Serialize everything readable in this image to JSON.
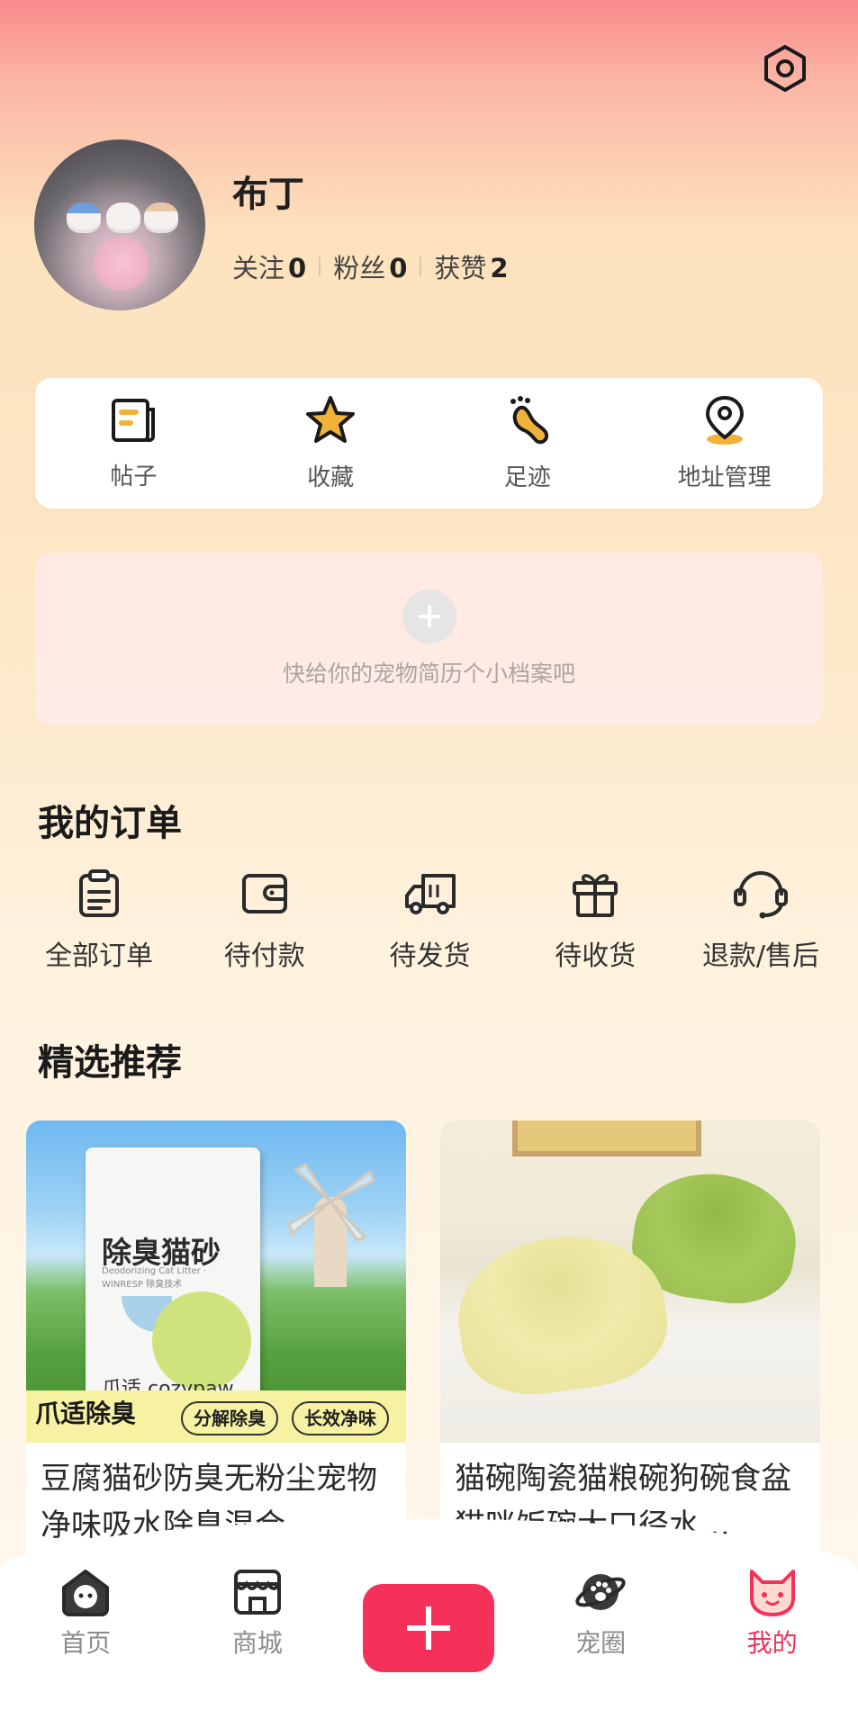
{
  "header": {
    "settings_icon": "settings-hexagon-icon"
  },
  "profile": {
    "username": "布丁",
    "stats": [
      {
        "label": "关注",
        "value": "0"
      },
      {
        "label": "粉丝",
        "value": "0"
      },
      {
        "label": "获赞",
        "value": "2"
      }
    ]
  },
  "quick_actions": [
    {
      "label": "帖子",
      "icon": "posts-icon"
    },
    {
      "label": "收藏",
      "icon": "star-icon"
    },
    {
      "label": "足迹",
      "icon": "footprint-icon"
    },
    {
      "label": "地址管理",
      "icon": "location-pin-icon"
    }
  ],
  "pet_profile": {
    "hint": "快给你的宠物简历个小档案吧"
  },
  "orders": {
    "title": "我的订单",
    "items": [
      {
        "label": "全部订单",
        "icon": "clipboard-icon"
      },
      {
        "label": "待付款",
        "icon": "wallet-icon"
      },
      {
        "label": "待发货",
        "icon": "truck-icon"
      },
      {
        "label": "待收货",
        "icon": "gift-icon"
      },
      {
        "label": "退款/售后",
        "icon": "headset-icon"
      }
    ]
  },
  "recommend": {
    "title": "精选推荐",
    "products": [
      {
        "title": "豆腐猫砂防臭无粉尘宠物净味吸水除臭混合…",
        "image_text": {
          "bag_title": "除臭猫砂",
          "bag_sub": "Deodorizing Cat Litter · WINRESP 除臭技术",
          "brand": "爪适 cozypaw",
          "banner": "爪适除臭",
          "pill1": "分解除臭",
          "pill2": "长效净味"
        }
      },
      {
        "title": "猫碗陶瓷猫粮碗狗碗食盆猫咪饭碗大口径水…"
      }
    ]
  },
  "nav": {
    "items": [
      {
        "label": "首页",
        "icon": "home-icon"
      },
      {
        "label": "商城",
        "icon": "store-icon"
      },
      {
        "label": "",
        "icon": "plus-icon"
      },
      {
        "label": "宠圈",
        "icon": "paw-planet-icon"
      },
      {
        "label": "我的",
        "icon": "cat-face-icon"
      }
    ],
    "active": "我的",
    "accent": "#f5315a"
  }
}
